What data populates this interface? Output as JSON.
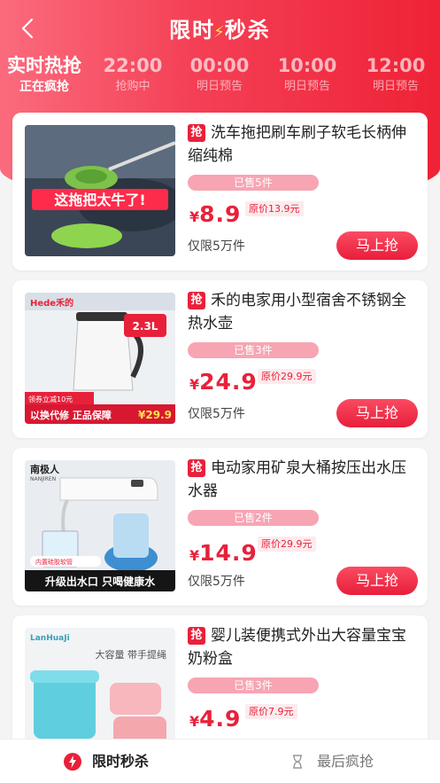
{
  "header": {
    "title_left": "限时",
    "title_right": "秒杀"
  },
  "time_slots": [
    {
      "time": "实时热抢",
      "status": "正在疯抢",
      "active": true
    },
    {
      "time": "22:00",
      "status": "抢购中",
      "active": false
    },
    {
      "time": "00:00",
      "status": "明日预告",
      "active": false
    },
    {
      "time": "10:00",
      "status": "明日预告",
      "active": false
    },
    {
      "time": "12:00",
      "status": "明日预告",
      "active": false
    }
  ],
  "badge_label": "抢",
  "buy_label": "马上抢",
  "products": [
    {
      "name": "洗车拖把刷车刷子软毛长柄伸缩纯棉",
      "sold": "已售5件",
      "price_symbol": "¥",
      "price": "8.9",
      "original": "原价13.9元",
      "limit": "仅限5万件",
      "image_text": "这拖把太牛了!"
    },
    {
      "name": "禾的电家用小型宿舍不锈钢全热水壶",
      "sold": "已售3件",
      "price_symbol": "¥",
      "price": "24.9",
      "original": "原价29.9元",
      "limit": "仅限5万件",
      "image_text": "以换代修 正品保障",
      "image_brand": "Hede禾的",
      "image_size": "2.3L",
      "image_coupon": "领券立减10元",
      "image_price": "¥29.9"
    },
    {
      "name": "电动家用矿泉大桶按压出水压水器",
      "sold": "已售2件",
      "price_symbol": "¥",
      "price": "14.9",
      "original": "原价29.9元",
      "limit": "仅限5万件",
      "image_text": "升级出水口 只喝健康水",
      "image_brand": "南极人",
      "image_brand_sub": "NANJIREN",
      "image_note": "内置硅胶软管"
    },
    {
      "name": "婴儿装便携式外出大容量宝宝奶粉盒",
      "sold": "已售3件",
      "price_symbol": "¥",
      "price": "4.9",
      "original": "原价7.9元",
      "limit": "",
      "image_text": "大容量 带手提绳",
      "image_brand": "LanHuaJi"
    }
  ],
  "tabbar": {
    "active_label": "限时秒杀",
    "inactive_label": "最后疯抢"
  },
  "colors": {
    "primary": "#e8213a",
    "accent_yellow": "#ffe14f",
    "sold_bg": "#f7a5b3"
  }
}
